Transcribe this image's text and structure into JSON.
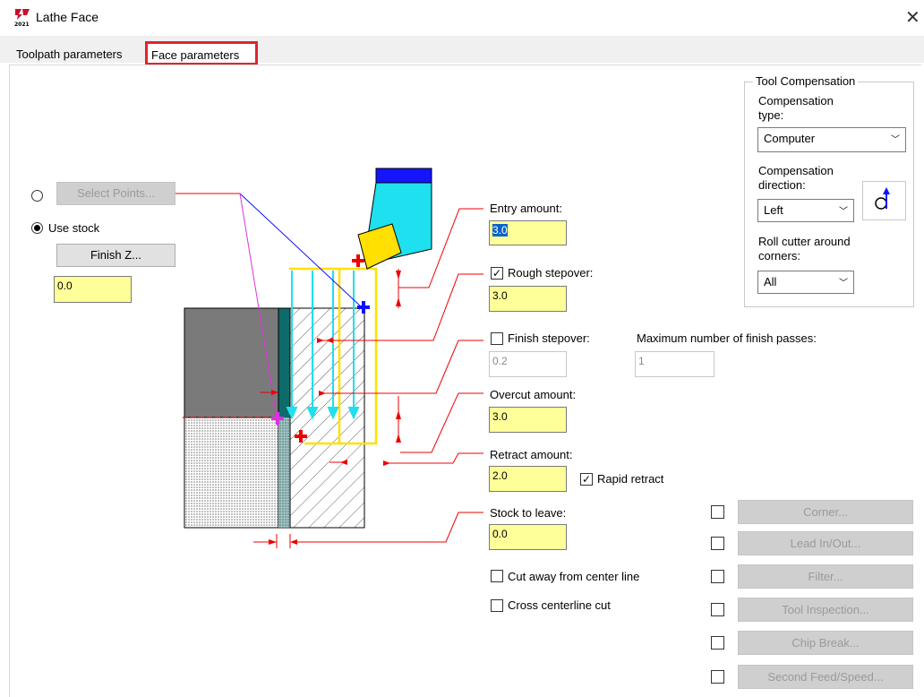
{
  "window": {
    "title": "Lathe Face",
    "close_glyph": "✕",
    "icon_text": "2021"
  },
  "tabs": [
    {
      "label": "Toolpath parameters",
      "active": false
    },
    {
      "label": "Face parameters",
      "active": true
    }
  ],
  "left": {
    "select_points_label": "Select Points...",
    "use_stock_label": "Use stock",
    "finish_z_label": "Finish Z...",
    "finish_z_value": "0.0",
    "use_stock_selected": true
  },
  "fields": {
    "entry_amount": {
      "label": "Entry amount:",
      "value": "3.0"
    },
    "rough_stepover": {
      "label": "Rough stepover:",
      "value": "3.0",
      "checked": true
    },
    "finish_stepover": {
      "label": "Finish stepover:",
      "value": "0.2",
      "checked": false
    },
    "max_finish_passes": {
      "label": "Maximum number of finish passes:",
      "value": "1"
    },
    "overcut_amount": {
      "label": "Overcut amount:",
      "value": "3.0"
    },
    "retract_amount": {
      "label": "Retract amount:",
      "value": "2.0"
    },
    "rapid_retract": {
      "label": "Rapid retract",
      "checked": true
    },
    "stock_to_leave": {
      "label": "Stock to leave:",
      "value": "0.0"
    },
    "cut_away": {
      "label": "Cut away from center line",
      "checked": false
    },
    "cross_centerline": {
      "label": "Cross centerline cut",
      "checked": false
    }
  },
  "tool_compensation": {
    "group_label": "Tool Compensation",
    "type_label": "Compensation type:",
    "type_value": "Computer",
    "direction_label": "Compensation direction:",
    "direction_value": "Left",
    "roll_label": "Roll cutter around corners:",
    "roll_value": "All"
  },
  "right_buttons": [
    {
      "label": "Corner...",
      "checked": false
    },
    {
      "label": "Lead In/Out...",
      "checked": false
    },
    {
      "label": "Filter...",
      "checked": false
    },
    {
      "label": "Tool Inspection...",
      "checked": false
    },
    {
      "label": "Chip Break...",
      "checked": false
    },
    {
      "label": "Second Feed/Speed...",
      "checked": false
    }
  ],
  "icons": [
    "app-logo-icon",
    "close-icon",
    "compensation-direction-icon",
    "chevron-down-icon"
  ]
}
